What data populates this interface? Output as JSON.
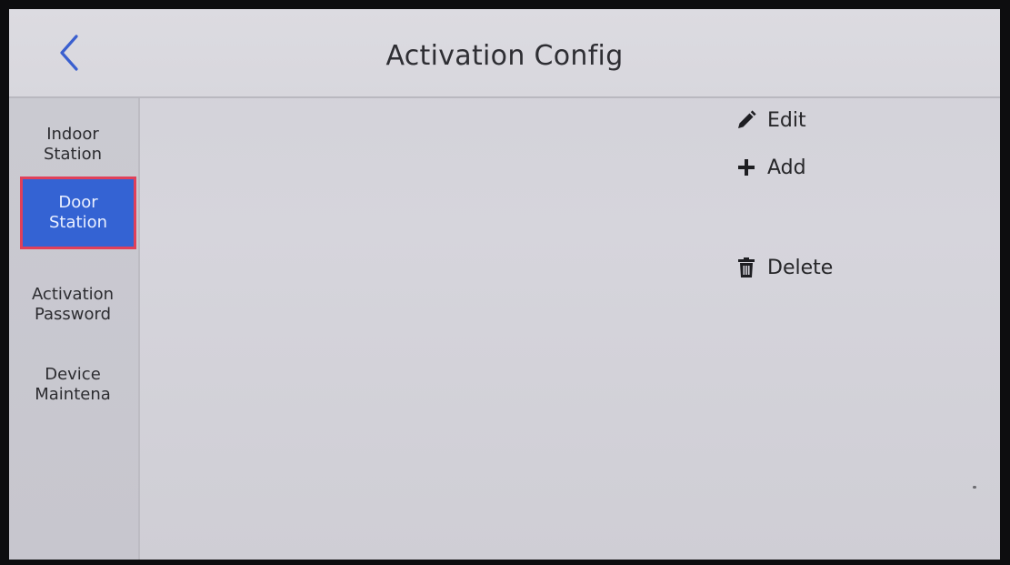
{
  "header": {
    "back_icon": "chevron-left-icon",
    "title": "Activation Config"
  },
  "sidebar": {
    "items": [
      {
        "label": "Indoor\nStation",
        "active": false
      },
      {
        "label": "Door\nStation",
        "active": true
      },
      {
        "label": "Activation\nPassword",
        "active": false
      },
      {
        "label": "Device\nMaintena",
        "active": false
      }
    ]
  },
  "actions": {
    "edit": {
      "label": "Edit",
      "icon": "pencil-icon"
    },
    "add": {
      "label": "Add",
      "icon": "plus-icon"
    },
    "delete": {
      "label": "Delete",
      "icon": "trash-icon"
    }
  },
  "colors": {
    "accent": "#3463d3",
    "selection_border": "#e0405a",
    "back_icon": "#3a5fcf"
  }
}
